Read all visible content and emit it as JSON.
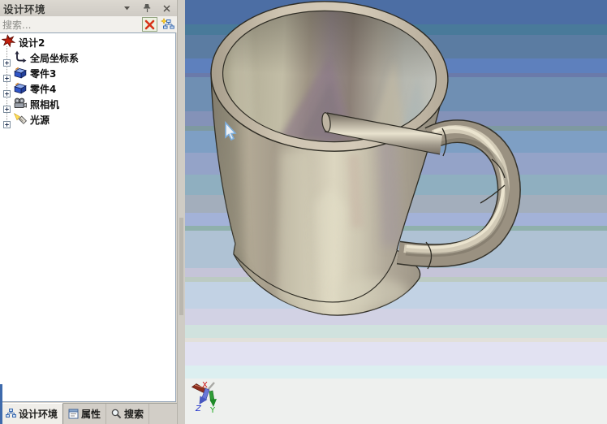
{
  "panel": {
    "title": "设计环境",
    "header_icons": {
      "collapse": "chevron-down",
      "pin": "pin",
      "close": "close"
    },
    "search": {
      "placeholder": "搜索...",
      "clear_icon": "red-x-clear",
      "advanced_icon": "hierarchy-with-star"
    }
  },
  "tree": {
    "items": [
      {
        "label": "设计2",
        "icon": "design-root",
        "has_expander": false
      },
      {
        "label": "全局坐标系",
        "icon": "coordinate-system",
        "has_expander": true
      },
      {
        "label": "零件3",
        "icon": "part",
        "has_expander": true
      },
      {
        "label": "零件4",
        "icon": "part",
        "has_expander": true
      },
      {
        "label": "照相机",
        "icon": "camera",
        "has_expander": true
      },
      {
        "label": "光源",
        "icon": "light-source",
        "has_expander": true
      }
    ]
  },
  "tabs": [
    {
      "label": "设计环境",
      "icon": "hierarchy-tree",
      "active": true
    },
    {
      "label": "属性",
      "icon": "properties-sheet",
      "active": false
    },
    {
      "label": "搜索",
      "icon": "magnifier",
      "active": false
    }
  ],
  "viewport": {
    "scene_description": "3D shaded mug model with handle",
    "axis_triad": {
      "x": "X",
      "y": "Y",
      "z": "Z"
    },
    "colors": {
      "bg_top": "#4c6ea4",
      "bg_bottom": "#eef0ee",
      "mug_base": "#b5ad9c",
      "mug_highlight": "#dcd6c0",
      "outline": "#2e2c24",
      "axis_x": "#cc1111",
      "axis_y": "#1faa1f",
      "axis_z": "#2233cc"
    }
  }
}
